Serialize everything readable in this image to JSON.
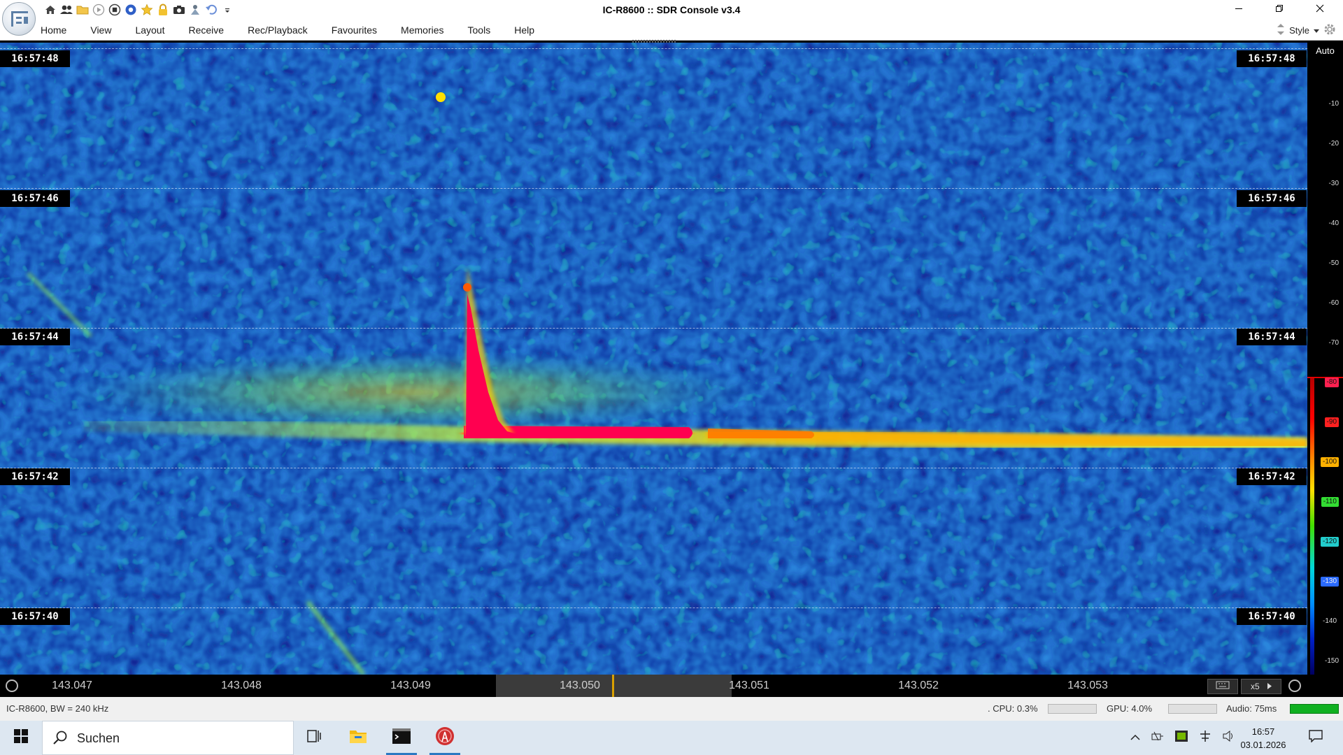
{
  "window": {
    "title": "IC-R8600 :: SDR Console v3.4",
    "controls": [
      "minimize-icon",
      "restore-icon",
      "close-icon"
    ]
  },
  "quick_access": [
    "home-icon",
    "users-icon",
    "folder-icon",
    "play-icon",
    "stop-icon",
    "globe-icon",
    "star-icon",
    "lock-icon",
    "camera-icon",
    "pin-icon",
    "undo-icon",
    "dropdown-icon"
  ],
  "menu": {
    "items": [
      "Home",
      "View",
      "Layout",
      "Receive",
      "Rec/Playback",
      "Favourites",
      "Memories",
      "Tools",
      "Help"
    ],
    "style_label": "Style"
  },
  "waterfall": {
    "time_labels": [
      "16:57:48",
      "16:57:46",
      "16:57:44",
      "16:57:42",
      "16:57:40"
    ],
    "signal_color": "#ff0050"
  },
  "scale": {
    "auto_label": "Auto",
    "ticks": [
      "-10",
      "-20",
      "-30",
      "-40",
      "-50",
      "-60",
      "-70",
      "-80",
      "-90",
      "-100",
      "-110",
      "-120",
      "-130",
      "-140",
      "-150"
    ],
    "boxed_ticks": {
      "-80": "#ff2050",
      "-90": "#ff2020",
      "-100": "#ffb000",
      "-110": "#33dd33",
      "-120": "#22cccc",
      "-130": "#2a6aff",
      "-140": "#000000"
    }
  },
  "frequency_axis": {
    "labels": [
      "143.047",
      "143.048",
      "143.049",
      "143.050",
      "143.051",
      "143.052",
      "143.053"
    ],
    "zoom": "x5"
  },
  "status": {
    "device": "IC-R8600, BW = 240 kHz",
    "cpu": ". CPU: 0.3%",
    "gpu": "GPU: 4.0%",
    "audio": "Audio: 75ms",
    "audio_level_color": "#10b020"
  },
  "taskbar": {
    "search_placeholder": "Suchen",
    "time": "16:57",
    "date": "03.01.2026"
  }
}
